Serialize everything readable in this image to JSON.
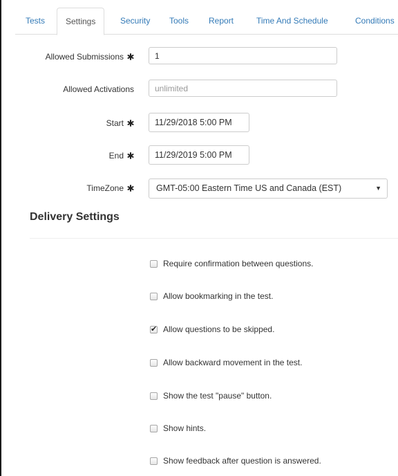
{
  "tabs": [
    {
      "label": "Tests",
      "active": false
    },
    {
      "label": "Settings",
      "active": true
    },
    {
      "label": "Security",
      "active": false
    },
    {
      "label": "Tools",
      "active": false
    },
    {
      "label": "Report",
      "active": false
    },
    {
      "label": "Time And Schedule",
      "active": false
    },
    {
      "label": "Conditions",
      "active": false
    }
  ],
  "form": {
    "allowed_submissions": {
      "label": "Allowed Submissions",
      "value": "1",
      "required": true
    },
    "allowed_activations": {
      "label": "Allowed Activations",
      "placeholder": "unlimited",
      "required": false
    },
    "start": {
      "label": "Start",
      "value": "11/29/2018 5:00 PM",
      "required": true
    },
    "end": {
      "label": "End",
      "value": "11/29/2019 5:00 PM",
      "required": true
    },
    "timezone": {
      "label": "TimeZone",
      "value": "GMT-05:00 Eastern Time US and Canada (EST)",
      "required": true,
      "caret": "▼"
    }
  },
  "delivery": {
    "title": "Delivery Settings",
    "options": [
      {
        "label": "Require confirmation between questions.",
        "checked": false
      },
      {
        "label": "Allow bookmarking in the test.",
        "checked": false
      },
      {
        "label": "Allow questions to be skipped.",
        "checked": true
      },
      {
        "label": "Allow backward movement in the test.",
        "checked": false
      },
      {
        "label": "Show the test \"pause\" button.",
        "checked": false
      },
      {
        "label": "Show hints.",
        "checked": false
      },
      {
        "label": "Show feedback after question is answered.",
        "checked": false
      }
    ]
  },
  "icons": {
    "required": "asterisk-icon",
    "dropdown": "chevron-down-icon",
    "check": "check-icon"
  },
  "colors": {
    "link": "#337ab7",
    "text": "#333333",
    "border": "#cccccc"
  }
}
